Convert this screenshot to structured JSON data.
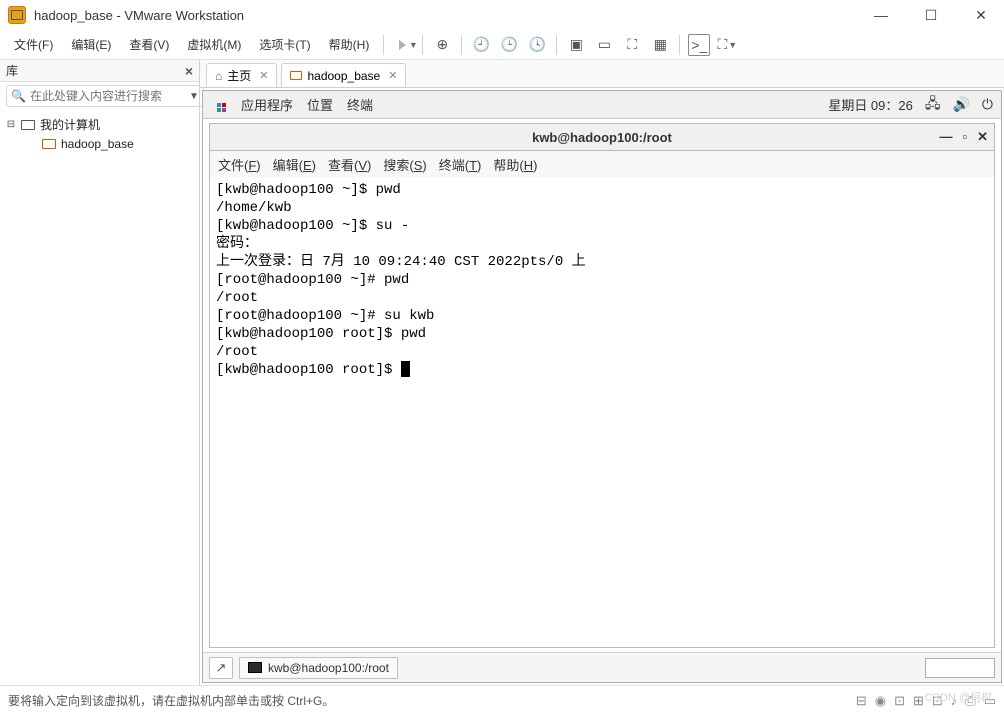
{
  "window": {
    "title": "hadoop_base - VMware Workstation"
  },
  "menubar": {
    "file": "文件(F)",
    "edit": "编辑(E)",
    "view": "查看(V)",
    "vm": "虚拟机(M)",
    "tabs": "选项卡(T)",
    "help": "帮助(H)"
  },
  "sidebar": {
    "title": "库",
    "search_placeholder": "在此处键入内容进行搜索",
    "root": "我的计算机",
    "item": "hadoop_base"
  },
  "tabs": {
    "home": "主页",
    "vm": "hadoop_base"
  },
  "gnome": {
    "apps": "应用程序",
    "places": "位置",
    "terminal": "终端",
    "clock": "星期日 09：26"
  },
  "terminal": {
    "title": "kwb@hadoop100:/root",
    "menu": {
      "file": "文件(F)",
      "edit": "编辑(E)",
      "view": "查看(V)",
      "search": "搜索(S)",
      "terminal": "终端(T)",
      "help": "帮助(H)"
    },
    "lines": [
      "[kwb@hadoop100 ~]$ pwd",
      "/home/kwb",
      "[kwb@hadoop100 ~]$ su -",
      "密码：",
      "上一次登录：日 7月 10 09:24:40 CST 2022pts/0 上",
      "[root@hadoop100 ~]# pwd",
      "/root",
      "[root@hadoop100 ~]# su kwb",
      "[kwb@hadoop100 root]$ pwd",
      "/root",
      "[kwb@hadoop100 root]$ "
    ]
  },
  "task": {
    "label": "kwb@hadoop100:/root"
  },
  "status": {
    "hint": "要将输入定向到该虚拟机，请在虚拟机内部单击或按 Ctrl+G。"
  },
  "watermark": "CSDN @柯权"
}
